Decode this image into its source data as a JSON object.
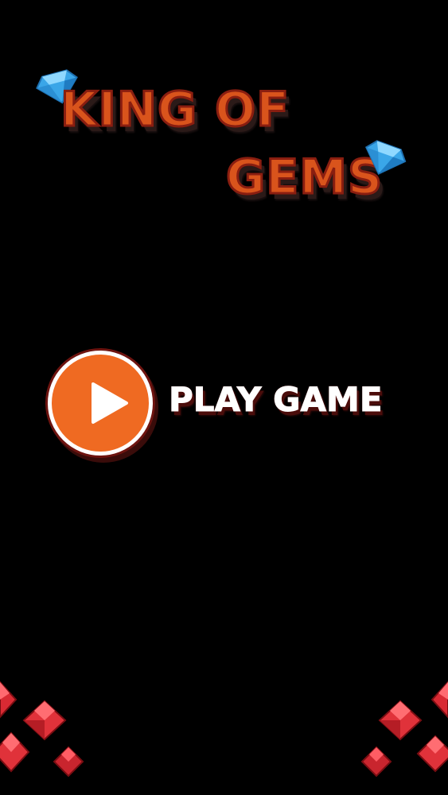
{
  "title": {
    "line1": "KING OF",
    "line2": "GEMS"
  },
  "menu": {
    "play_label": "PLAY GAME"
  },
  "colors": {
    "background": "#000000",
    "title_fill": "#d9541c",
    "title_outline": "#8a1e10",
    "play_button": "#ef6a22",
    "play_button_ring": "#ffffff",
    "gem_blue": "#4fc3f7",
    "gem_red": "#e0323a"
  },
  "icons": {
    "title_gems": "blue-diamond-icon",
    "play": "play-triangle-icon",
    "decor": "red-diamond-gem-icon"
  }
}
